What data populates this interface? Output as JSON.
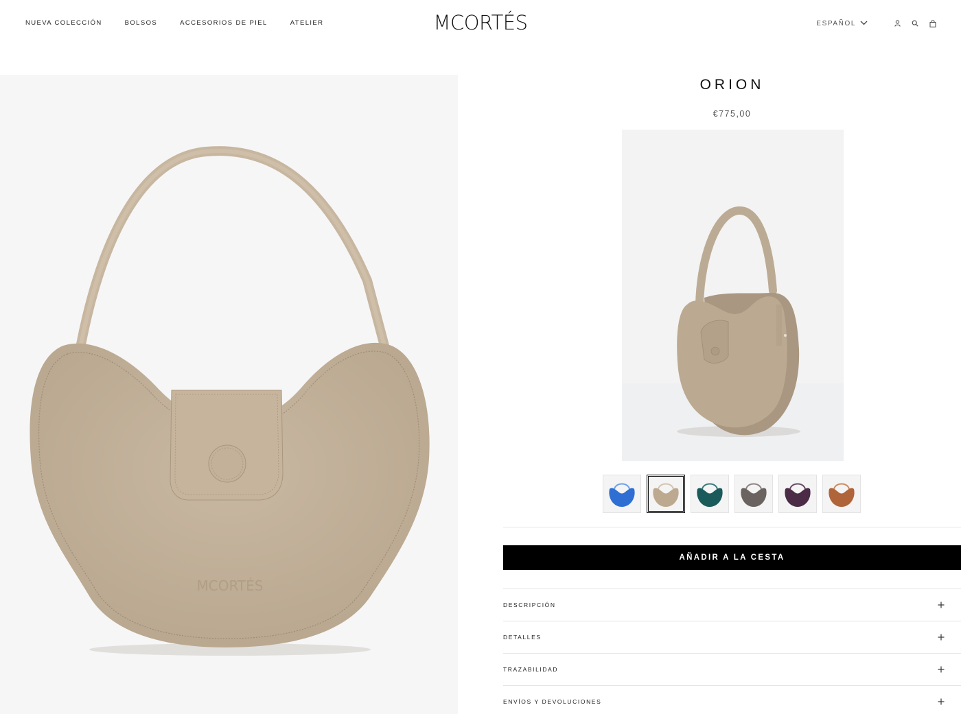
{
  "header": {
    "nav": [
      {
        "label": "NUEVA COLECCIÓN"
      },
      {
        "label": "BOLSOS"
      },
      {
        "label": "ACCESORIOS DE PIEL"
      },
      {
        "label": "ATELIER"
      }
    ],
    "logo": "MCORTÉS",
    "language": "ESPAÑOL",
    "icons": [
      "user-icon",
      "search-icon",
      "bag-icon",
      "chevron-down-icon"
    ]
  },
  "product": {
    "title": "ORION",
    "price": "€775,00",
    "image_watermark": "MCORTÉS",
    "swatches": [
      {
        "name": "blue",
        "color": "#2f6fd4"
      },
      {
        "name": "taupe",
        "color": "#bda98f",
        "selected": true
      },
      {
        "name": "teal",
        "color": "#1b5a5b"
      },
      {
        "name": "grey",
        "color": "#6b6360"
      },
      {
        "name": "plum",
        "color": "#4b2b45"
      },
      {
        "name": "cognac",
        "color": "#b0643a"
      }
    ],
    "add_to_cart": "AÑADIR A LA CESTA",
    "accordion": [
      {
        "label": "DESCRIPCIÓN"
      },
      {
        "label": "DETALLES"
      },
      {
        "label": "TRAZABILIDAD"
      },
      {
        "label": "ENVÍOS Y DEVOLUCIONES"
      }
    ],
    "accordion_icon": "plus-icon",
    "bag_color": "#c2b09a"
  }
}
